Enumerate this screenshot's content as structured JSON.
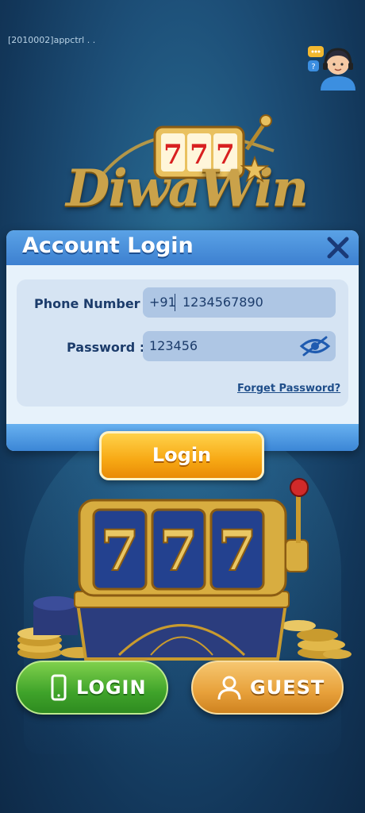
{
  "debug_label": "[2010002]appctrl . .",
  "logo": {
    "digits": "777",
    "brand": "DiwaWin"
  },
  "dialog": {
    "title": "Account Login",
    "phone_label": "Phone Number :",
    "country_code": "+91",
    "phone_value": "1234567890",
    "password_label": "Password :",
    "password_value": "123456",
    "forget_link": "Forget Password?"
  },
  "login_button": "Login",
  "slot_digits": [
    "7",
    "7",
    "7"
  ],
  "bottom_buttons": {
    "login": "LOGIN",
    "guest": "GUEST"
  },
  "icons": {
    "close": "close-icon",
    "eye": "eye-slash-icon",
    "phone": "phone-icon",
    "user": "user-icon",
    "support": "customer-support-icon"
  },
  "colors": {
    "dialog_header": "#3d80d0",
    "login_orange": "#f7a814",
    "login_green": "#3fa32a",
    "guest_orange": "#e7a03a"
  }
}
